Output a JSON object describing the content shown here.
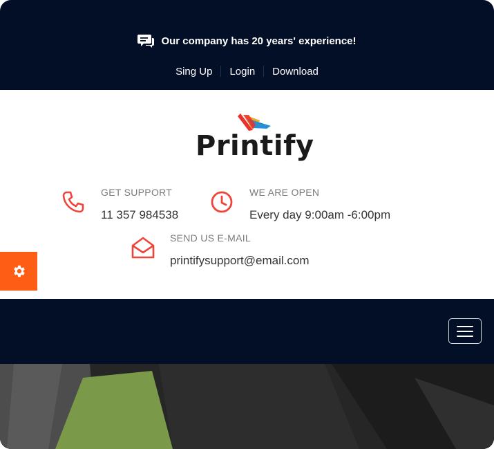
{
  "topbar": {
    "announcement": "Our company has 20 years' experience!",
    "links": [
      "Sing Up",
      "Login",
      "Download"
    ]
  },
  "brand": {
    "name": "Printify"
  },
  "contact": {
    "support_label": "GET SUPPORT",
    "support_value": "11 357 984538",
    "hours_label": "WE ARE OPEN",
    "hours_value": "Every day 9:00am -6:00pm",
    "email_label": "SEND US E-MAIL",
    "email_value": "printifysupport@email.com"
  },
  "icons": {
    "announcement": "chat-bubble-icon",
    "support": "phone-icon",
    "hours": "clock-icon",
    "email": "envelope-open-icon",
    "settings": "gear-icon",
    "menu": "hamburger-menu-icon"
  },
  "colors": {
    "dark": "#030f27",
    "accent": "#fd5d14",
    "icon_red": "#f0443a"
  }
}
